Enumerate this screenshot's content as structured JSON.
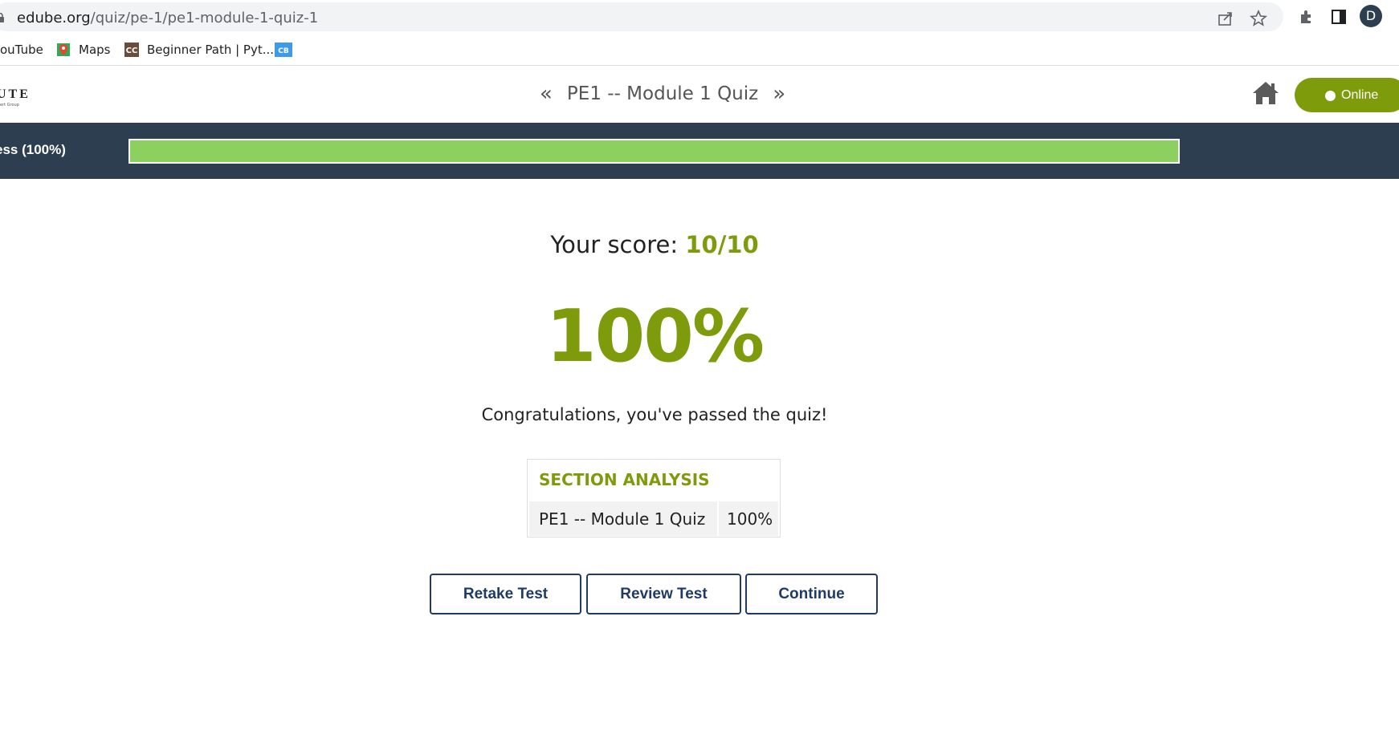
{
  "browser": {
    "url_domain": "edube.org",
    "url_path": "/quiz/pe-1/pe1-module-1-quiz-1",
    "profile_initial": "D",
    "icons": [
      "lock-icon",
      "share-icon",
      "star-icon",
      "extensions-icon",
      "side-panel-icon"
    ]
  },
  "bookmarks": [
    {
      "label": "ouTube",
      "icon": "youtube-icon"
    },
    {
      "label": "Maps",
      "icon": "maps-icon"
    },
    {
      "label": "Beginner Path | Pyt...",
      "icon": "cc-icon"
    },
    {
      "label": "",
      "icon": "cb-icon"
    }
  ],
  "header": {
    "logo_text": "UTE",
    "logo_sub": "ert Group",
    "quiz_title": "PE1 -- Module 1 Quiz",
    "prev_symbol": "«",
    "next_symbol": "»",
    "online_label": "Online",
    "accent_color": "#7d9b0b"
  },
  "progress": {
    "label": "ess (100%)",
    "value_percent": 100,
    "bar_color": "#8cd160",
    "band_color": "#2c3e50"
  },
  "result": {
    "score_prefix": "Your score:",
    "score_value": "10/10",
    "percent": "100%",
    "message": "Congratulations, you've passed the quiz!"
  },
  "section_analysis": {
    "title": "SECTION ANALYSIS",
    "rows": [
      {
        "name": "PE1 -- Module 1 Quiz",
        "value": "100%"
      }
    ]
  },
  "actions": {
    "retake_label": "Retake Test",
    "review_label": "Review Test",
    "continue_label": "Continue"
  }
}
